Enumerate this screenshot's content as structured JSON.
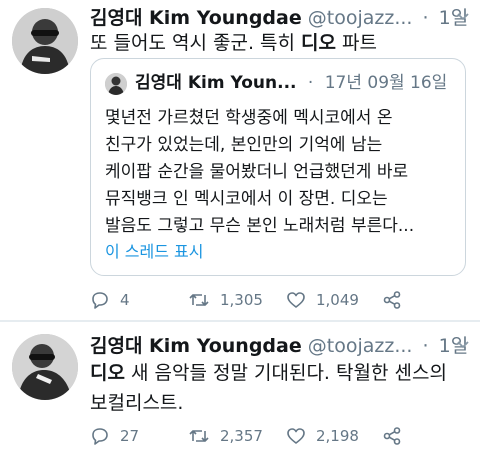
{
  "tweets": [
    {
      "author": {
        "name": "김영대 Kim Youngdae",
        "handle": "@toojazz..."
      },
      "time": "1일",
      "text_plain": "또 들어도 역시 좋군. 특히 ",
      "text_bold": "디오",
      "text_rest": " 파트",
      "quote": {
        "author_name": "김영대 Kim Youn...",
        "time": "17년 09월 16일",
        "lines": [
          "몇년전 가르쳤던 학생중에 멕시코에서 온",
          "친구가 있었는데, 본인만의 기억에 남는",
          "케이팝 순간을 물어봤더니 언급했던게 바로",
          "뮤직뱅크 인 멕시코에서 이 장면. 디오는",
          "발음도 그렇고 무슨 본인 노래처럼 부른다..."
        ],
        "show_thread": "이 스레드 표시"
      },
      "stats": {
        "replies": "4",
        "retweets": "1,305",
        "likes": "1,049"
      }
    },
    {
      "author": {
        "name": "김영대 Kim Youngdae",
        "handle": "@toojazz..."
      },
      "time": "1일",
      "line1_bold": "디오",
      "line1_rest": " 새 음악들 정말 기대된다. 탁월한 센스의",
      "line2": "보컬리스트.",
      "stats": {
        "replies": "27",
        "retweets": "2,357",
        "likes": "2,198"
      }
    }
  ],
  "colors": {
    "text": "#14171a",
    "secondary": "#657786",
    "link": "#1b95e0",
    "border": "#ccd6dd"
  },
  "icons": [
    "reply-icon",
    "retweet-icon",
    "like-icon",
    "share-icon",
    "chevron-down-icon"
  ]
}
